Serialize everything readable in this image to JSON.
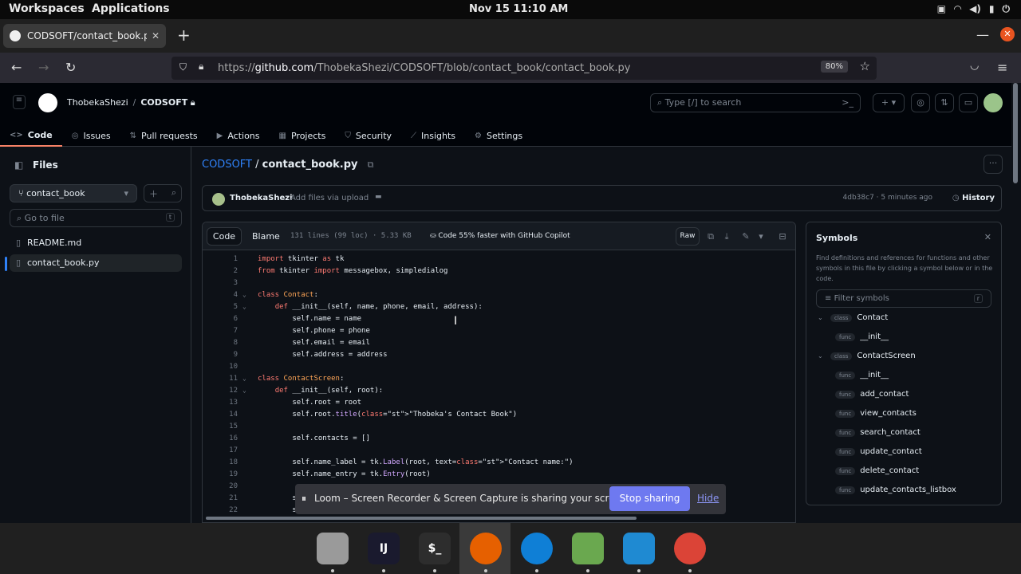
{
  "os": {
    "workspaces": "Workspaces",
    "applications": "Applications",
    "clock": "Nov 15  11:10 AM"
  },
  "browser": {
    "tab_title": "CODSOFT/contact_book.py",
    "url_prefix": "https://",
    "url_host": "github.com",
    "url_path": "/ThobekaShezi/CODSOFT/blob/contact_book/contact_book.py",
    "zoom": "80%"
  },
  "github": {
    "owner": "ThobekaShezi",
    "repo": "CODSOFT",
    "search_placeholder": "Type [/] to search",
    "tabs": [
      {
        "label": "Code",
        "icon": "code-icon"
      },
      {
        "label": "Issues",
        "icon": "issue-icon"
      },
      {
        "label": "Pull requests",
        "icon": "pull-request-icon"
      },
      {
        "label": "Actions",
        "icon": "play-icon"
      },
      {
        "label": "Projects",
        "icon": "table-icon"
      },
      {
        "label": "Security",
        "icon": "shield-icon"
      },
      {
        "label": "Insights",
        "icon": "graph-icon"
      },
      {
        "label": "Settings",
        "icon": "gear-icon"
      }
    ]
  },
  "files": {
    "title": "Files",
    "branch": "contact_book",
    "goto_placeholder": "Go to file",
    "goto_shortcut": "t",
    "items": [
      "README.md",
      "contact_book.py"
    ],
    "selected": "contact_book.py"
  },
  "main": {
    "repo_link": "CODSOFT",
    "file_name": "contact_book.py",
    "commit_author": "ThobekaShezi",
    "commit_message": "Add files via upload",
    "commit_meta": "4db38c7 · 5 minutes ago",
    "history": "History",
    "code_tab": "Code",
    "blame_tab": "Blame",
    "file_meta": "131 lines (99 loc) · 5.33 KB",
    "copilot": "Code 55% faster with GitHub Copilot",
    "raw": "Raw"
  },
  "code_lines": [
    {
      "n": "1",
      "t": "import tkinter as tk"
    },
    {
      "n": "2",
      "t": "from tkinter import messagebox, simpledialog"
    },
    {
      "n": "3",
      "t": ""
    },
    {
      "n": "4",
      "t": "class Contact:",
      "fold": true
    },
    {
      "n": "5",
      "t": "    def __init__(self, name, phone, email, address):",
      "fold": true
    },
    {
      "n": "6",
      "t": "        self.name = name"
    },
    {
      "n": "7",
      "t": "        self.phone = phone"
    },
    {
      "n": "8",
      "t": "        self.email = email"
    },
    {
      "n": "9",
      "t": "        self.address = address"
    },
    {
      "n": "10",
      "t": ""
    },
    {
      "n": "11",
      "t": "class ContactScreen:",
      "fold": true
    },
    {
      "n": "12",
      "t": "    def __init__(self, root):",
      "fold": true
    },
    {
      "n": "13",
      "t": "        self.root = root"
    },
    {
      "n": "14",
      "t": "        self.root.title(\"Thobeka's Contact Book\")"
    },
    {
      "n": "15",
      "t": ""
    },
    {
      "n": "16",
      "t": "        self.contacts = []"
    },
    {
      "n": "17",
      "t": ""
    },
    {
      "n": "18",
      "t": "        self.name_label = tk.Label(root, text=\"Contact name:\")"
    },
    {
      "n": "19",
      "t": "        self.name_entry = tk.Entry(root)"
    },
    {
      "n": "20",
      "t": ""
    },
    {
      "n": "21",
      "t": "        s"
    },
    {
      "n": "22",
      "t": "        s"
    }
  ],
  "symbols": {
    "title": "Symbols",
    "description": "Find definitions and references for functions and other symbols in this file by clicking a symbol below or in the code.",
    "filter_placeholder": "Filter symbols",
    "filter_shortcut": "r",
    "items": [
      {
        "kind": "class",
        "name": "Contact",
        "level": 0
      },
      {
        "kind": "func",
        "name": "__init__",
        "level": 1
      },
      {
        "kind": "class",
        "name": "ContactScreen",
        "level": 0
      },
      {
        "kind": "func",
        "name": "__init__",
        "level": 1
      },
      {
        "kind": "func",
        "name": "add_contact",
        "level": 1
      },
      {
        "kind": "func",
        "name": "view_contacts",
        "level": 1
      },
      {
        "kind": "func",
        "name": "search_contact",
        "level": 1
      },
      {
        "kind": "func",
        "name": "update_contact",
        "level": 1
      },
      {
        "kind": "func",
        "name": "delete_contact",
        "level": 1
      },
      {
        "kind": "func",
        "name": "update_contacts_listbox",
        "level": 1
      }
    ]
  },
  "loom": {
    "message": "Loom – Screen Recorder & Screen Capture is sharing your screen.",
    "stop": "Stop sharing",
    "hide": "Hide"
  },
  "dock": [
    {
      "name": "files-app-icon",
      "color": "#9a9a9a",
      "label": ""
    },
    {
      "name": "intellij-app-icon",
      "color": "#1a1a2e",
      "label": "IJ"
    },
    {
      "name": "terminal-app-icon",
      "color": "#2d2d2d",
      "label": "$_"
    },
    {
      "name": "firefox-app-icon",
      "color": "#e66000",
      "label": ""
    },
    {
      "name": "edge-app-icon",
      "color": "#0f7fd6",
      "label": ""
    },
    {
      "name": "archive-manager-app-icon",
      "color": "#6aa84f",
      "label": ""
    },
    {
      "name": "vscode-app-icon",
      "color": "#1f8ad2",
      "label": ""
    },
    {
      "name": "chrome-app-icon",
      "color": "#db4437",
      "label": ""
    }
  ]
}
